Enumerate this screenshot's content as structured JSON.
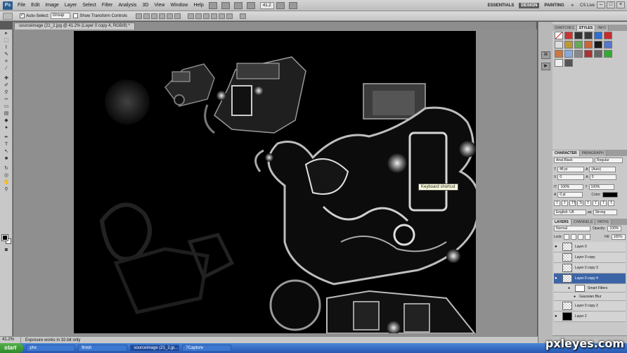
{
  "menubar": {
    "logo": "Ps",
    "items": [
      "File",
      "Edit",
      "Image",
      "Layer",
      "Select",
      "Filter",
      "Analysis",
      "3D",
      "View",
      "Window",
      "Help"
    ],
    "zoom": "41.2",
    "workspaces": [
      "ESSENTIALS",
      "DESIGN",
      "PAINTING"
    ],
    "active_workspace": "DESIGN",
    "more": "»",
    "cslive": "CS Live"
  },
  "options": {
    "auto_select_label": "Auto-Select:",
    "auto_select_value": "Group",
    "transform_label": "Show Transform Controls"
  },
  "document": {
    "tab_title": "sourceimage (21_2.jpg @ 41.2% (Layer 0 copy 4, RGB/8) *",
    "tooltip": "Keyboard shortcut"
  },
  "status": {
    "zoom": "41.2%",
    "message": "Exposure works in 32-bit only"
  },
  "styles_panel": {
    "tabs": [
      "SWATCHES",
      "STYLES",
      "INFO"
    ],
    "active": "STYLES"
  },
  "character_panel": {
    "tabs": [
      "CHARACTER",
      "PARAGRAPH"
    ],
    "font": "Arial Black",
    "style": "Regular",
    "size": "48 pt",
    "leading": "(Auto)",
    "kerning": "0",
    "tracking": "0",
    "vscale": "100%",
    "hscale": "100%",
    "baseline": "0 pt",
    "color_label": "Color:",
    "language": "English: UK",
    "antialias": "Strong"
  },
  "layers_panel": {
    "tabs": [
      "LAYERS",
      "CHANNELS",
      "PATHS"
    ],
    "blend_mode": "Normal",
    "opacity_label": "Opacity:",
    "opacity": "100%",
    "lock_label": "Lock:",
    "fill_label": "Fill:",
    "fill": "100%",
    "layers": [
      {
        "name": "Layer 0",
        "visible": true,
        "active": false
      },
      {
        "name": "Layer 0 copy",
        "visible": false,
        "active": false
      },
      {
        "name": "Layer 0 copy 3",
        "visible": false,
        "active": false
      },
      {
        "name": "Layer 0 copy 4",
        "visible": true,
        "active": true
      }
    ],
    "sublayers": [
      "Smart Filters",
      "Gaussian Blur"
    ],
    "layers_bottom": [
      {
        "name": "Layer 0 copy 2",
        "visible": false
      },
      {
        "name": "Layer 2",
        "visible": true
      }
    ]
  },
  "taskbar": {
    "start": "start",
    "tasks": [
      "phx",
      "finish",
      "sourceimage (21_2.jp...",
      "7Capture"
    ]
  },
  "watermark": "pxleyes.com",
  "colors": {
    "canvas": "#000000",
    "active_layer": "#3c65a8",
    "taskbar": "#2558b5"
  }
}
